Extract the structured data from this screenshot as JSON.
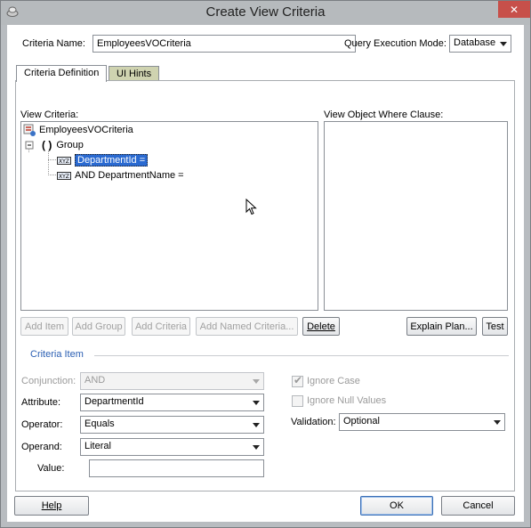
{
  "window": {
    "title": "Create View Criteria",
    "close_glyph": "✕"
  },
  "header": {
    "criteria_name_label": "Criteria Name:",
    "criteria_name_value": "EmployeesVOCriteria",
    "query_mode_label": "Query Execution Mode:",
    "query_mode_value": "Database"
  },
  "tabs": [
    {
      "label": "Criteria Definition",
      "active": true
    },
    {
      "label": "UI Hints",
      "active": false
    }
  ],
  "view_criteria": {
    "label": "View Criteria:",
    "tree": {
      "root": "EmployeesVOCriteria",
      "group_glyph": "( )",
      "group": "Group",
      "item1": "DepartmentId =",
      "item2": "AND DepartmentName ="
    }
  },
  "where_clause": {
    "label": "View Object Where Clause:",
    "value": ""
  },
  "toolbar": {
    "add_item": "Add Item",
    "add_group": "Add Group",
    "add_criteria": "Add Criteria",
    "add_named_criteria": "Add Named Criteria...",
    "delete": "Delete",
    "explain_plan": "Explain Plan...",
    "test": "Test"
  },
  "criteria_item": {
    "section_title": "Criteria Item",
    "conjunction_label": "Conjunction:",
    "conjunction_value": "AND",
    "attribute_label": "Attribute:",
    "attribute_value": "DepartmentId",
    "operator_label": "Operator:",
    "operator_value": "Equals",
    "operand_label": "Operand:",
    "operand_value": "Literal",
    "value_label": "Value:",
    "value_value": "",
    "ignore_case_label": "Ignore Case",
    "ignore_case_checked": true,
    "ignore_nulls_label": "Ignore Null Values",
    "ignore_nulls_checked": false,
    "validation_label": "Validation:",
    "validation_value": "Optional"
  },
  "footer": {
    "help": "Help",
    "ok": "OK",
    "cancel": "Cancel"
  },
  "icons": {
    "app": "app-icon",
    "root": "view-criteria-icon",
    "expander": "tree-collapse-icon",
    "item": "criteria-item-icon",
    "pointer": "mouse-pointer-icon"
  }
}
